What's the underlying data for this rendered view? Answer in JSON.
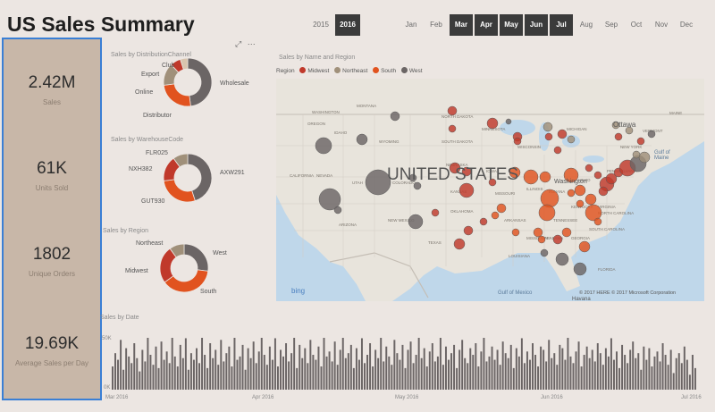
{
  "title": "US Sales Summary",
  "slicer": {
    "years": [
      {
        "label": "2015",
        "selected": false
      },
      {
        "label": "2016",
        "selected": true
      }
    ],
    "months": [
      {
        "label": "Jan",
        "selected": false
      },
      {
        "label": "Feb",
        "selected": false
      },
      {
        "label": "Mar",
        "selected": true
      },
      {
        "label": "Apr",
        "selected": true
      },
      {
        "label": "May",
        "selected": true
      },
      {
        "label": "Jun",
        "selected": true
      },
      {
        "label": "Jul",
        "selected": true
      },
      {
        "label": "Aug",
        "selected": false
      },
      {
        "label": "Sep",
        "selected": false
      },
      {
        "label": "Oct",
        "selected": false
      },
      {
        "label": "Nov",
        "selected": false
      },
      {
        "label": "Dec",
        "selected": false
      }
    ]
  },
  "kpis": [
    {
      "value": "2.42M",
      "label": "Sales"
    },
    {
      "value": "61K",
      "label": "Units Sold"
    },
    {
      "value": "1802",
      "label": "Unique Orders"
    },
    {
      "value": "19.69K",
      "label": "Average Sales per Day"
    }
  ],
  "colors": {
    "accent": "#3a7fd5",
    "midwest": "#c0392b",
    "northeast": "#a0907a",
    "south": "#e1531f",
    "west": "#6b6565",
    "kpi_bg": "#c8b7a8"
  },
  "donuts": [
    {
      "title": "Sales by DistributionChannel",
      "slices": [
        {
          "label": "Wholesale",
          "value": 48,
          "color": "#6b6565"
        },
        {
          "label": "Distributor",
          "value": 25,
          "color": "#e1531f"
        },
        {
          "label": "Online",
          "value": 15,
          "color": "#a0907a"
        },
        {
          "label": "Export",
          "value": 7,
          "color": "#c0392b"
        },
        {
          "label": "Club",
          "value": 5,
          "color": "#d8c4ad"
        }
      ]
    },
    {
      "title": "Sales by WarehouseCode",
      "slices": [
        {
          "label": "AXW291",
          "value": 45,
          "color": "#6b6565"
        },
        {
          "label": "GUT930",
          "value": 28,
          "color": "#e1531f"
        },
        {
          "label": "NXH382",
          "value": 17,
          "color": "#c0392b"
        },
        {
          "label": "FLR025",
          "value": 10,
          "color": "#a0907a"
        }
      ]
    },
    {
      "title": "Sales by Region",
      "slices": [
        {
          "label": "West",
          "value": 27,
          "color": "#6b6565"
        },
        {
          "label": "South",
          "value": 38,
          "color": "#e1531f"
        },
        {
          "label": "Midwest",
          "value": 25,
          "color": "#c0392b"
        },
        {
          "label": "Northeast",
          "value": 10,
          "color": "#a0907a"
        }
      ]
    }
  ],
  "map": {
    "title": "Sales by Name and Region",
    "legend_title": "Region",
    "legend": [
      "Midwest",
      "Northeast",
      "South",
      "West"
    ],
    "country_label": "UNITED STATES",
    "places": [
      "Ottawa",
      "Washington",
      "Gulf of Maine",
      "Gulf of Mexico",
      "Havana"
    ],
    "states": [
      "WASHINGTON",
      "MONTANA",
      "IDAHO",
      "WYOMING",
      "NEVADA",
      "UTAH",
      "COLORADO",
      "KANSAS",
      "NEBRASKA",
      "SOUTH DAKOTA",
      "NORTH DAKOTA",
      "MINNESOTA",
      "IOWA",
      "ILLINOIS",
      "WISCONSIN",
      "MICHIGAN",
      "OHIO",
      "INDIANA",
      "KENTUCKY",
      "TENNESSEE",
      "MISSISSIPPI",
      "ALABAMA",
      "GEORGIA",
      "LOUISIANA",
      "TEXAS",
      "OKLAHOMA",
      "ARKANSAS",
      "MISSOURI",
      "NEW MEXICO",
      "ARIZONA",
      "CALIFORNIA",
      "OREGON",
      "VIRGINIA",
      "PENNSYLVANIA",
      "NEW YORK",
      "SOUTH CAROLINA",
      "NORTH CAROLINA",
      "MAINE",
      "VERMONT",
      "FLORIDA"
    ],
    "brand": "bing",
    "copyright": "© 2017 HERE © 2017 Microsoft Corporation"
  },
  "date_chart": {
    "title": "Sales by Date",
    "y_top": "50K",
    "y_bottom": "0K",
    "ticks": [
      "Mar 2016",
      "Apr 2016",
      "May 2016",
      "Jun 2016",
      "Jul 2016"
    ]
  },
  "chart_data": {
    "type": "bar",
    "title": "Sales by Date",
    "ylim": [
      0,
      50000
    ],
    "x_range": [
      "Mar 2016",
      "Jul 2016"
    ],
    "values": [
      14,
      22,
      18,
      30,
      12,
      25,
      20,
      16,
      28,
      19,
      11,
      24,
      17,
      33,
      21,
      15,
      26,
      13,
      29,
      18,
      23,
      16,
      35,
      20,
      14,
      27,
      19,
      31,
      12,
      22,
      18,
      25,
      16,
      37,
      21,
      13,
      28,
      19,
      24,
      15,
      30,
      17,
      22,
      26,
      14,
      33,
      18,
      20,
      27,
      12,
      25,
      19,
      29,
      16,
      23,
      38,
      21,
      15,
      26,
      18,
      31,
      14,
      24,
      20,
      28,
      17,
      22,
      34,
      13,
      27,
      19,
      25,
      16,
      30,
      21,
      18,
      26,
      14,
      32,
      20,
      23,
      17,
      29,
      15,
      24,
      36,
      19,
      22,
      27,
      13,
      25,
      18,
      31,
      16,
      21,
      28,
      14,
      24,
      19,
      33,
      17,
      26,
      20,
      15,
      30,
      22,
      18,
      27,
      13,
      24,
      29,
      16,
      21,
      35,
      19,
      25,
      14,
      23,
      28,
      17,
      20,
      32,
      15,
      26,
      18,
      22,
      27,
      13,
      24,
      30,
      19,
      16,
      25,
      21,
      28,
      14,
      23,
      34,
      17,
      20,
      26,
      18,
      24,
      15,
      29,
      22,
      19,
      27,
      13,
      25,
      20,
      31,
      16,
      23,
      18,
      28,
      21,
      14,
      26,
      24,
      17,
      30,
      19,
      22,
      15,
      27,
      25,
      18,
      33,
      20,
      16,
      23,
      29,
      14,
      21,
      26,
      19,
      24,
      17,
      28,
      22,
      15,
      25,
      20,
      31,
      18,
      23,
      13,
      27,
      21,
      16,
      24,
      29,
      19,
      22,
      12,
      26,
      18,
      25,
      14,
      20,
      23,
      17,
      28,
      21,
      15,
      24,
      10,
      19,
      22,
      16,
      26,
      18,
      9,
      21,
      13
    ]
  }
}
